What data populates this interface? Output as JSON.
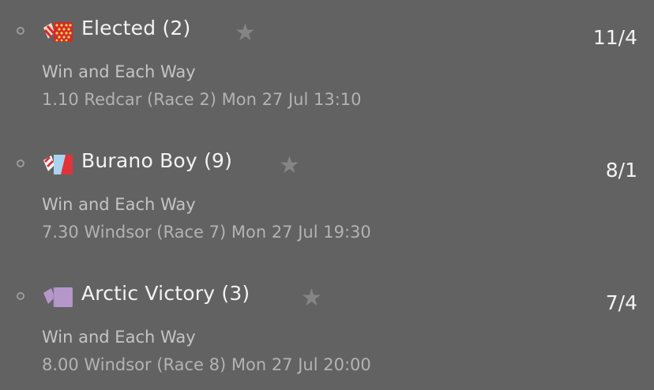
{
  "selections": [
    {
      "horse": "Elected (2)",
      "odds": "11/4",
      "market": "Win and Each Way",
      "race": "1.10 Redcar (Race 2) Mon 27 Jul 13:10",
      "silk_icon": "silk-red-yellow-dots-icon",
      "star_icon": "star-icon"
    },
    {
      "horse": "Burano Boy (9)",
      "odds": "8/1",
      "market": "Win and Each Way",
      "race": "7.30 Windsor (Race 7) Mon 27 Jul 19:30",
      "silk_icon": "silk-lightblue-red-icon",
      "star_icon": "star-icon"
    },
    {
      "horse": "Arctic Victory (3)",
      "odds": "7/4",
      "market": "Win and Each Way",
      "race": "8.00 Windsor (Race 8) Mon 27 Jul 20:00",
      "silk_icon": "silk-lilac-icon",
      "star_icon": "star-icon"
    }
  ],
  "colors": {
    "background": "#626262",
    "primary_text": "#f3f3f3",
    "secondary_text": "#c4c4c4",
    "star": "#858585"
  }
}
